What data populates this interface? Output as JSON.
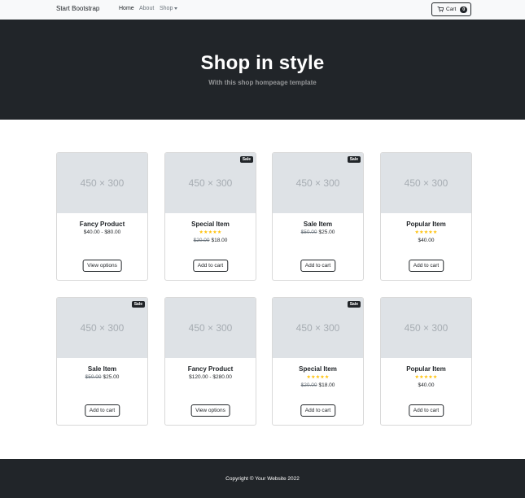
{
  "navbar": {
    "brand": "Start Bootstrap",
    "links": {
      "home": "Home",
      "about": "About",
      "shop": "Shop"
    },
    "cart": {
      "label": "Cart",
      "count": "0"
    }
  },
  "header": {
    "title": "Shop in style",
    "subtitle": "With this shop hompeage template"
  },
  "products": [
    {
      "image_text": "450 × 300",
      "name": "Fancy Product",
      "price": "$40.00 - $80.00",
      "old_price": "",
      "button": "View options"
    },
    {
      "image_text": "450 × 300",
      "badge": "Sale",
      "name": "Special Item",
      "stars": "★★★★★",
      "old_price": "$20.00",
      "price": "$18.00",
      "button": "Add to cart"
    },
    {
      "image_text": "450 × 300",
      "badge": "Sale",
      "name": "Sale Item",
      "old_price": "$50.00",
      "price": "$25.00",
      "button": "Add to cart"
    },
    {
      "image_text": "450 × 300",
      "name": "Popular Item",
      "stars": "★★★★★",
      "old_price": "",
      "price": "$40.00",
      "button": "Add to cart"
    },
    {
      "image_text": "450 × 300",
      "badge": "Sale",
      "name": "Sale Item",
      "old_price": "$50.00",
      "price": "$25.00",
      "button": "Add to cart"
    },
    {
      "image_text": "450 × 300",
      "name": "Fancy Product",
      "old_price": "",
      "price": "$120.00 - $280.00",
      "button": "View options"
    },
    {
      "image_text": "450 × 300",
      "badge": "Sale",
      "name": "Special Item",
      "stars": "★★★★★",
      "old_price": "$20.00",
      "price": "$18.00",
      "button": "Add to cart"
    },
    {
      "image_text": "450 × 300",
      "name": "Popular Item",
      "stars": "★★★★★",
      "old_price": "",
      "price": "$40.00",
      "button": "Add to cart"
    }
  ],
  "footer": {
    "copyright": "Copyright © Your Website 2022"
  },
  "colors": {
    "dark": "#212529",
    "light": "#f8f9fa",
    "star": "#ffc107",
    "placeholder": "#dee2e6"
  },
  "icons": {
    "cart": "cart-icon",
    "dropdown": "chevron-down-icon"
  }
}
